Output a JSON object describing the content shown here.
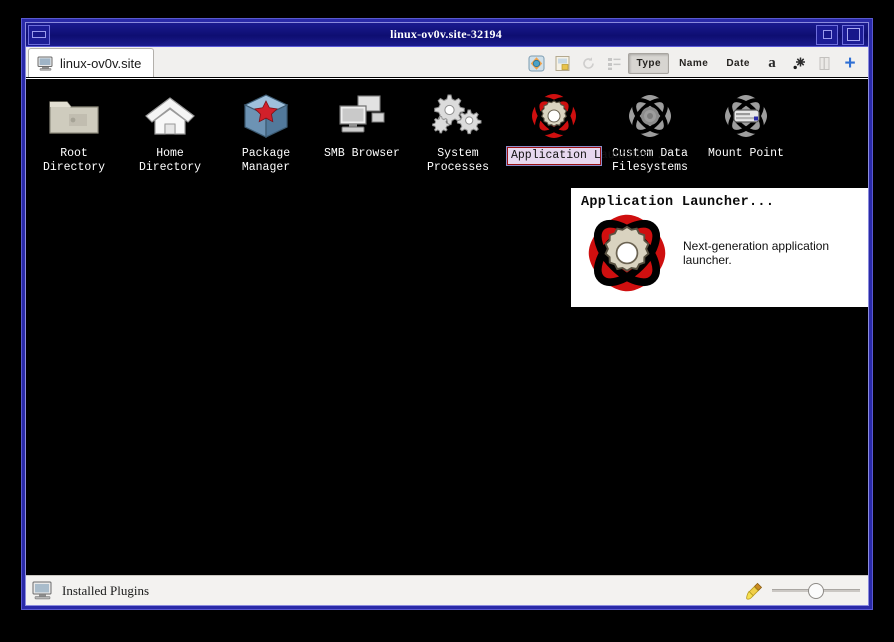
{
  "window": {
    "title": "linux-ov0v.site-32194",
    "controls": {
      "menu_button": "window-menu",
      "minimize_button": "minimize",
      "maximize_button": "maximize"
    }
  },
  "tab": {
    "label": "linux-ov0v.site",
    "icon": "computer-icon"
  },
  "toolbar": {
    "icons": [
      {
        "name": "preview-icon",
        "label": ""
      },
      {
        "name": "document-icon",
        "label": ""
      },
      {
        "name": "refresh-icon",
        "label": ""
      },
      {
        "name": "list-view-icon",
        "label": ""
      }
    ],
    "sort_buttons": [
      {
        "label": "Type",
        "pressed": true
      },
      {
        "label": "Name",
        "pressed": false
      },
      {
        "label": "Date",
        "pressed": false
      }
    ],
    "trailing_icons": [
      {
        "name": "text-size-icon",
        "label": "a"
      },
      {
        "name": "sparkle-icon",
        "label": ""
      },
      {
        "name": "column-icon",
        "label": ""
      },
      {
        "name": "add-icon",
        "label": "+"
      }
    ]
  },
  "desktop": {
    "icons": [
      {
        "label": "Root Directory",
        "icon": "folder-icon",
        "editing": false
      },
      {
        "label": "Home Directory",
        "icon": "home-icon",
        "editing": false
      },
      {
        "label": "Package Manager",
        "icon": "package-cube-icon",
        "editing": false
      },
      {
        "label": "SMB Browser",
        "icon": "network-share-icon",
        "editing": false
      },
      {
        "label": "System Processes",
        "icon": "gears-icon",
        "editing": false
      },
      {
        "label": "Application Launcher...",
        "icon": "atom-gear-red-icon",
        "editing": true
      },
      {
        "label": "Custom Data Filesystems",
        "icon": "atom-grey-icon",
        "editing": false
      },
      {
        "label": "Mount Point",
        "icon": "mount-disk-icon",
        "editing": false
      }
    ]
  },
  "tooltip": {
    "title": "Application Launcher...",
    "description": "Next-generation application launcher.",
    "icon": "atom-gear-red-icon"
  },
  "statusbar": {
    "icon": "computer-icon",
    "label": "Installed Plugins",
    "brush_icon": "brush-icon",
    "zoom_slider": "zoom-slider"
  },
  "colors": {
    "titlebar": "#0e0e72",
    "frame": "#2a2aa8",
    "desktop": "#000000",
    "toolbar_bg": "#f1f0ee",
    "accent_blue": "#2e6fd4",
    "edit_highlight": "#e7d8ef",
    "edit_border": "#9c1111"
  }
}
